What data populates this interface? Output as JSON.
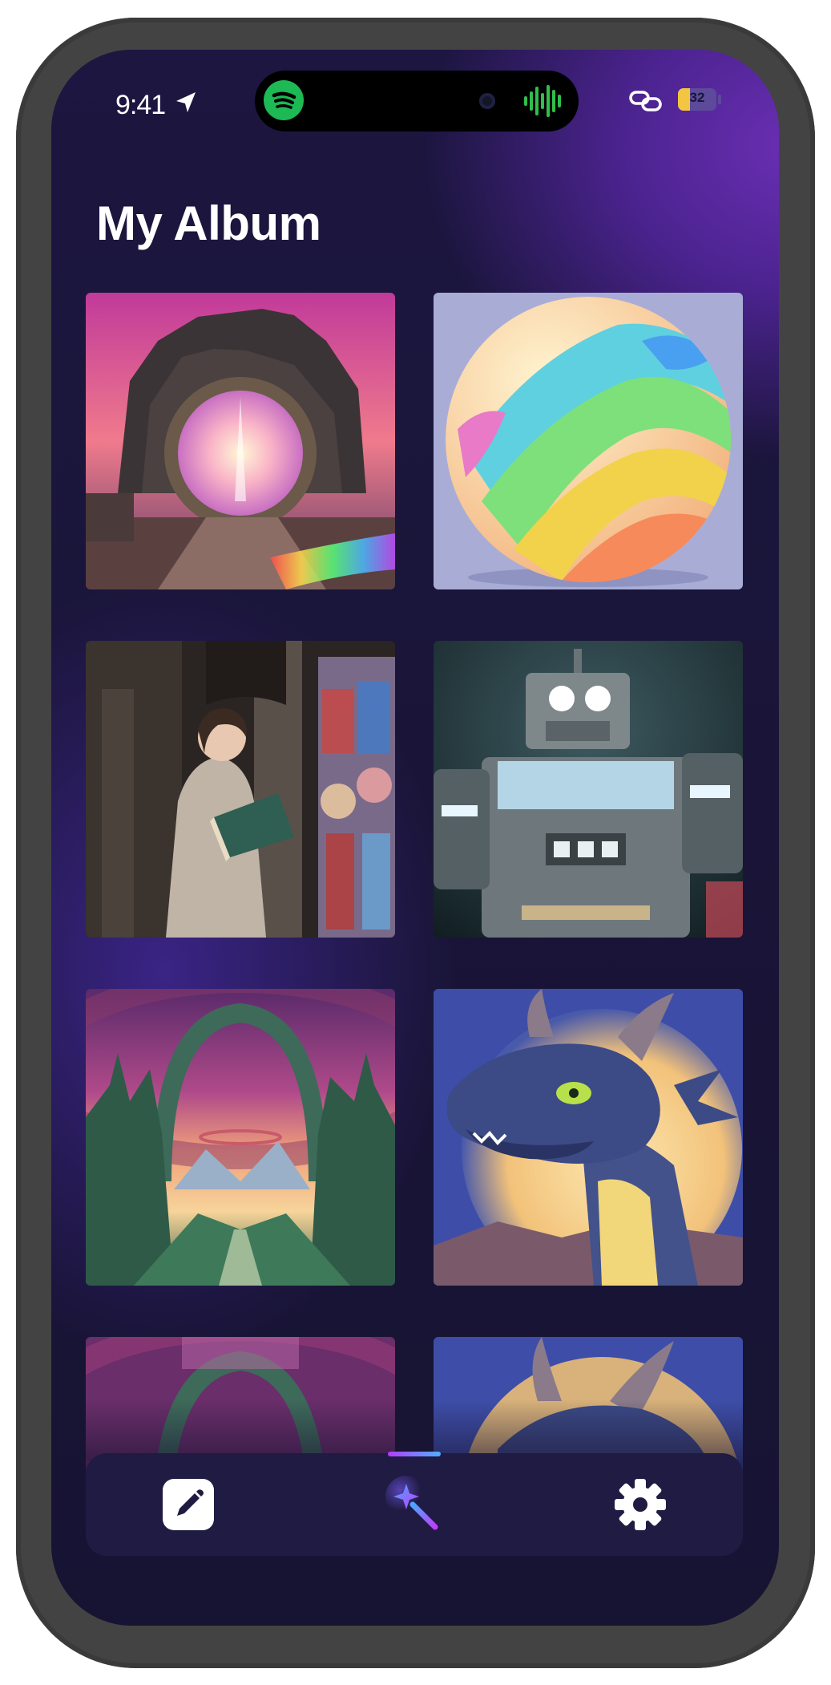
{
  "status_bar": {
    "time": "9:41",
    "battery_percent": "32",
    "icons": [
      "location-arrow-icon",
      "spotify-icon",
      "audio-wave-icon",
      "link-icon",
      "battery-icon"
    ]
  },
  "page": {
    "title": "My Album"
  },
  "album": {
    "items": [
      {
        "name": "portal-ruins",
        "icon": "image"
      },
      {
        "name": "rainbow-sphere",
        "icon": "image"
      },
      {
        "name": "girl-with-book",
        "icon": "image"
      },
      {
        "name": "robot",
        "icon": "image"
      },
      {
        "name": "fantasy-arch-valley",
        "icon": "image"
      },
      {
        "name": "blue-dragon",
        "icon": "image"
      },
      {
        "name": "fantasy-arch-valley-partial",
        "icon": "image"
      },
      {
        "name": "blue-dragon-partial",
        "icon": "image"
      }
    ]
  },
  "tab_bar": {
    "tabs": [
      {
        "icon": "edit-icon",
        "active": false
      },
      {
        "icon": "magic-wand-icon",
        "active": true
      },
      {
        "icon": "settings-gear-icon",
        "active": false
      }
    ],
    "active_indicator_colors": [
      "#b23cff",
      "#4fb1ff"
    ]
  },
  "colors": {
    "background": "#1a1538",
    "accent_purple": "#6a2fb3",
    "frame": "#434343",
    "tabbar": "#1f1b42"
  }
}
